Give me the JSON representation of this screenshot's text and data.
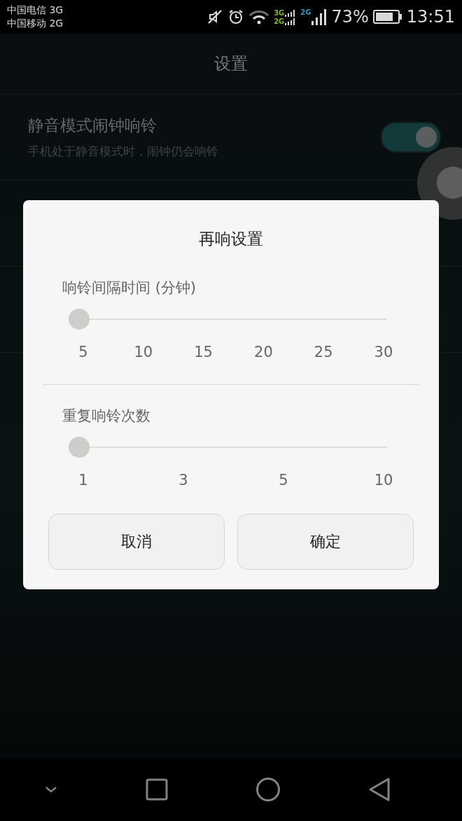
{
  "status_bar": {
    "carriers": [
      "中国电信 3G",
      "中国移动 2G"
    ],
    "network_labels": [
      "3G",
      "2G",
      "2G"
    ],
    "battery_percent": "73%",
    "time": "13:51"
  },
  "title": "设置",
  "settings": [
    {
      "title": "静音模式闹钟响铃",
      "subtitle": "手机处于静音模式时，闹钟仍会响铃",
      "on": true
    }
  ],
  "dialog": {
    "title": "再响设置",
    "sliders": [
      {
        "label": "响铃间隔时间 (分钟)",
        "level": 0,
        "ticks": [
          "5",
          "10",
          "15",
          "20",
          "25",
          "30"
        ]
      },
      {
        "label": "重复响铃次数",
        "level": 0,
        "ticks": [
          "1",
          "3",
          "5",
          "10"
        ]
      }
    ],
    "buttons": [
      "取消",
      "确定"
    ]
  }
}
